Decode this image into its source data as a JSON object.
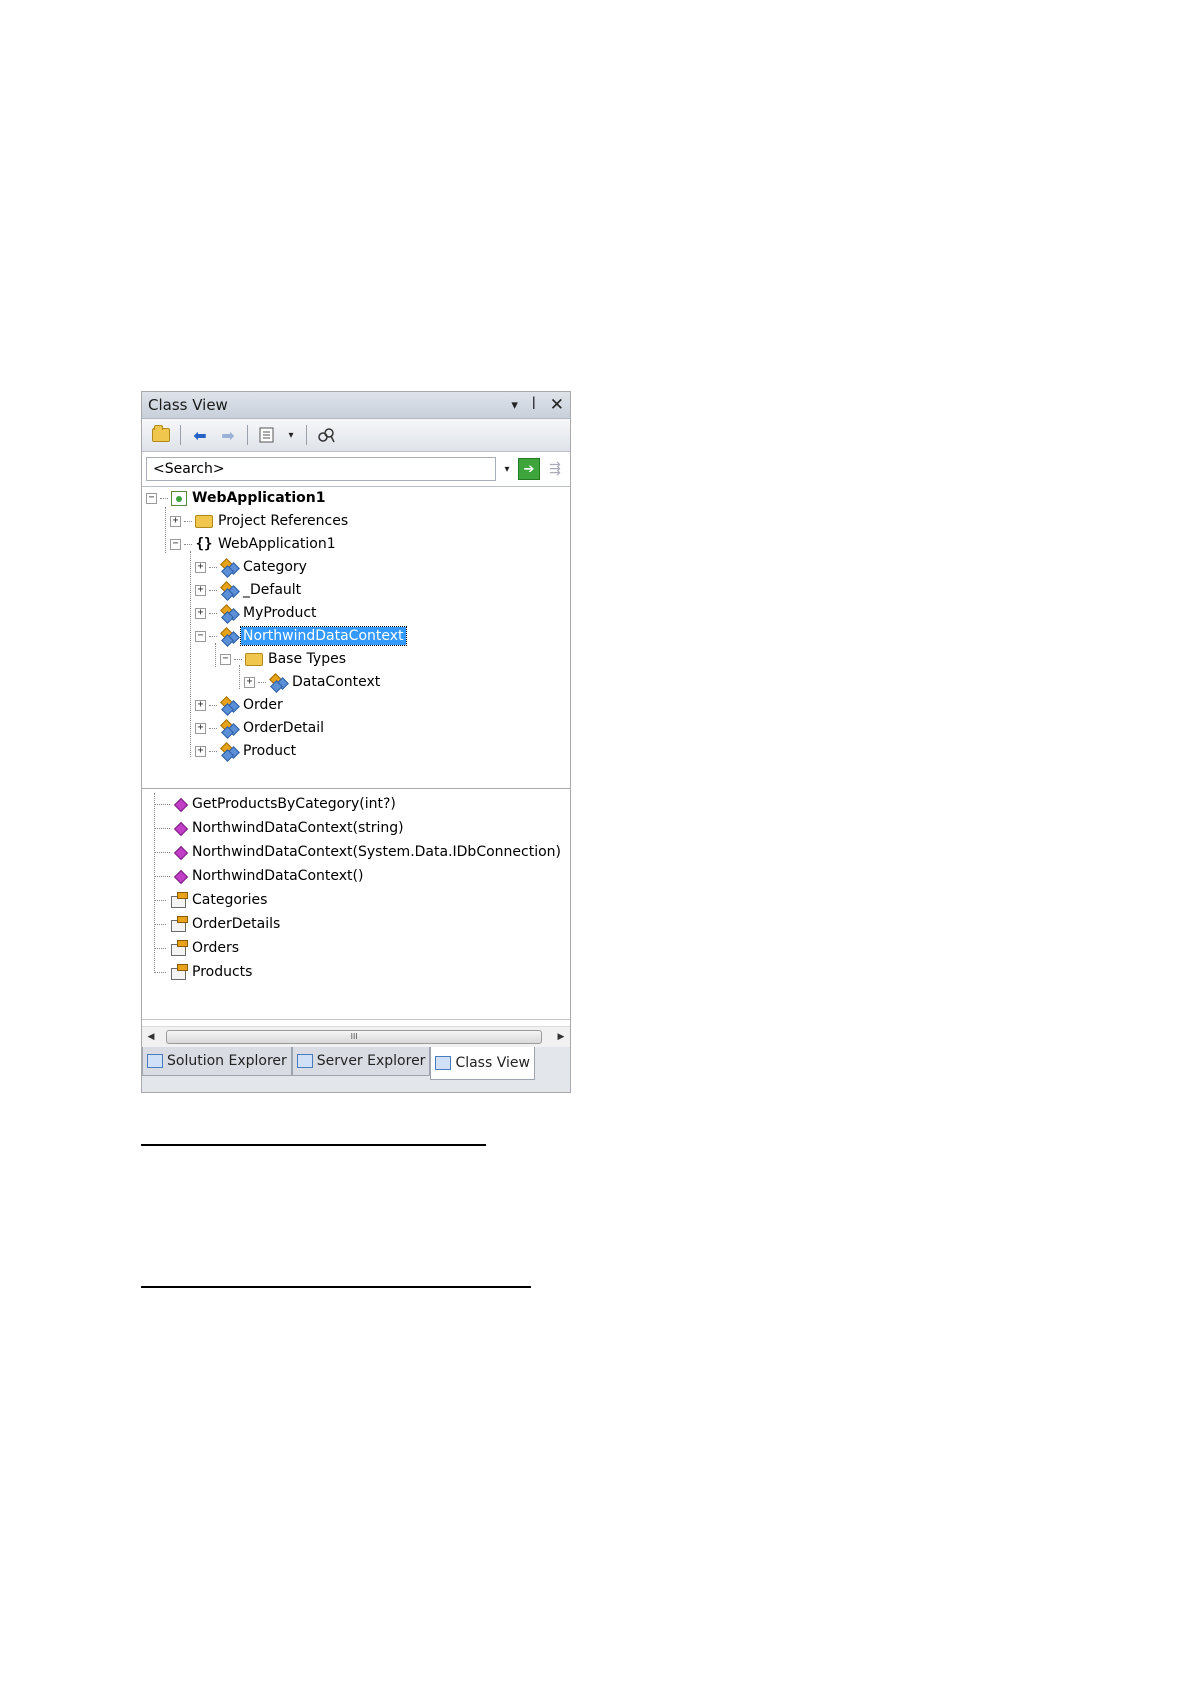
{
  "window": {
    "title": "Class View",
    "pin_glyph": "▾",
    "pushpin_glyph": "ꟾ",
    "close_glyph": "✕"
  },
  "search": {
    "value": "<Search>"
  },
  "tree": [
    {
      "label": "WebApplication1",
      "icon": "project-icon",
      "bold": true
    },
    {
      "label": "Project References",
      "icon": "folder-icon"
    },
    {
      "label": "WebApplication1",
      "icon": "namespace-icon"
    },
    {
      "label": "Category",
      "icon": "class-icon"
    },
    {
      "label": "_Default",
      "icon": "class-icon"
    },
    {
      "label": "MyProduct",
      "icon": "class-icon"
    },
    {
      "label": "NorthwindDataContext",
      "icon": "class-icon",
      "selected": true
    },
    {
      "label": "Base Types",
      "icon": "folder-icon"
    },
    {
      "label": "DataContext",
      "icon": "class-icon"
    },
    {
      "label": "Order",
      "icon": "class-icon"
    },
    {
      "label": "OrderDetail",
      "icon": "class-icon"
    },
    {
      "label": "Product",
      "icon": "class-icon"
    }
  ],
  "members": [
    {
      "label": "GetProductsByCategory(int?)",
      "icon": "method-icon"
    },
    {
      "label": "NorthwindDataContext(string)",
      "icon": "method-icon"
    },
    {
      "label": "NorthwindDataContext(System.Data.IDbConnection)",
      "icon": "method-icon"
    },
    {
      "label": "NorthwindDataContext()",
      "icon": "method-icon"
    },
    {
      "label": "Categories",
      "icon": "property-icon"
    },
    {
      "label": "OrderDetails",
      "icon": "property-icon"
    },
    {
      "label": "Orders",
      "icon": "property-icon"
    },
    {
      "label": "Products",
      "icon": "property-icon"
    }
  ],
  "scrollbar": {
    "thumb_glyph": "III"
  },
  "tabs": [
    {
      "label": "Solution Explorer"
    },
    {
      "label": "Server Explorer"
    },
    {
      "label": "Class View",
      "active": true
    }
  ],
  "colors": {
    "selection": "#3399ff",
    "accent_green": "#3da53b"
  }
}
